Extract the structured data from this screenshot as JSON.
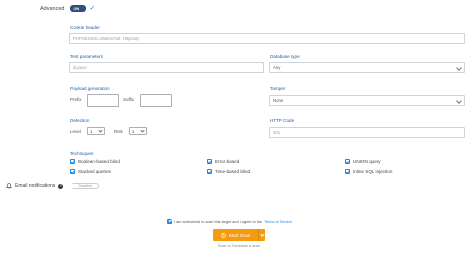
{
  "advanced": {
    "label": "Advanced",
    "toggle": "ON"
  },
  "cookie_header": {
    "label": "Cookie header",
    "placeholder": "PHPSESSID=38afes7a8; HttpOnly"
  },
  "test_parameters": {
    "label": "Test parameters",
    "placeholder": "id,pass"
  },
  "database_type": {
    "label": "Database type",
    "value": "Any"
  },
  "payload_generation": {
    "label": "Payload generation",
    "prefix_label": "Prefix",
    "suffix_label": "Suffix"
  },
  "tamper": {
    "label": "Tamper",
    "value": "None"
  },
  "detection": {
    "label": "Detection",
    "level_label": "Level",
    "level_value": "1",
    "risk_label": "Risk",
    "risk_value": "1"
  },
  "http_code": {
    "label": "HTTP Code",
    "placeholder": "401"
  },
  "techniques": {
    "label": "Techniques",
    "items": [
      "Boolean-based blind",
      "Error-based",
      "UNION query",
      "Stacked queries",
      "Time-based blind",
      "Inline SQL injection"
    ]
  },
  "email_notifications": {
    "label": "Email notifications",
    "help": "?",
    "toggle": "Disabled"
  },
  "authorization": {
    "text": "I am authorized to scan this target and I agree to the",
    "link": "Terms of Service"
  },
  "start_button": {
    "label": "Start Scan"
  },
  "schedule_text": "Scan or Schedule a scan",
  "colors": {
    "accent_blue": "#1e88e5",
    "orange": "#f39c12",
    "toggle_navy": "#2f4f7f"
  }
}
